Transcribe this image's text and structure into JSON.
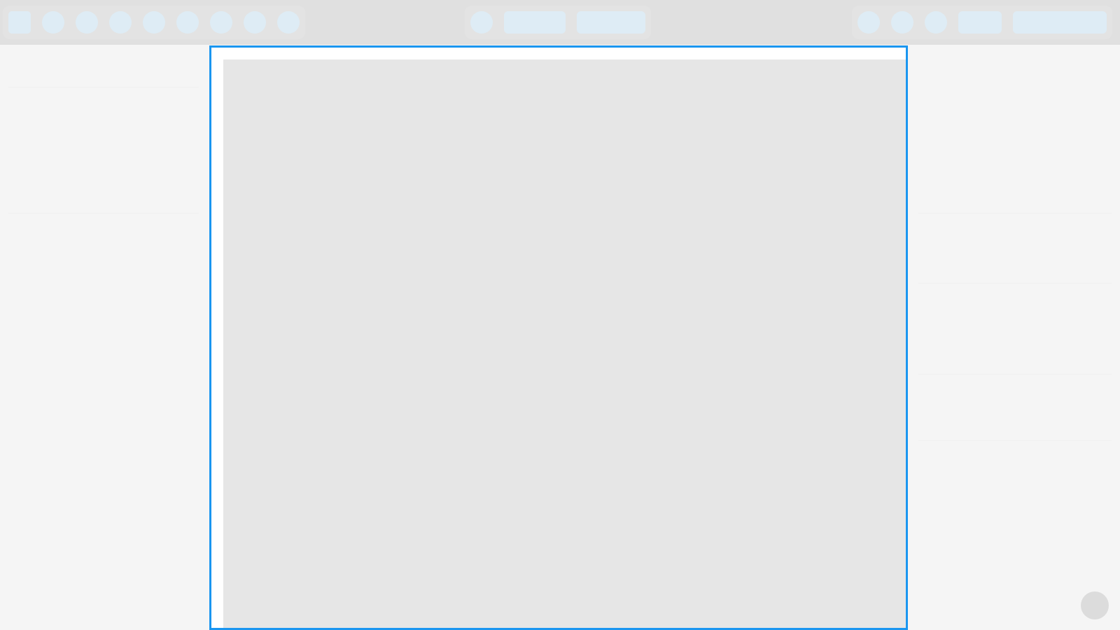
{
  "app": {
    "title": ""
  },
  "toolbar": {
    "left_group": [
      "menu",
      "tool-1",
      "tool-2",
      "tool-3",
      "tool-4",
      "tool-5",
      "tool-6",
      "tool-7",
      "tool-8"
    ],
    "middle_group": [
      "view-toggle",
      "view-option-1",
      "view-option-2"
    ],
    "right_group": [
      "action-1",
      "action-2",
      "action-3",
      "secondary-button",
      "primary-button"
    ]
  },
  "colors": {
    "toolbar_background": "#e0e0e0",
    "control_placeholder": "#deecf5",
    "selection_accent": "#1a96f0",
    "canvas_background": "#e6e6e6",
    "panel_background": "#f5f5f5"
  },
  "icons": {
    "help": "help-icon"
  }
}
